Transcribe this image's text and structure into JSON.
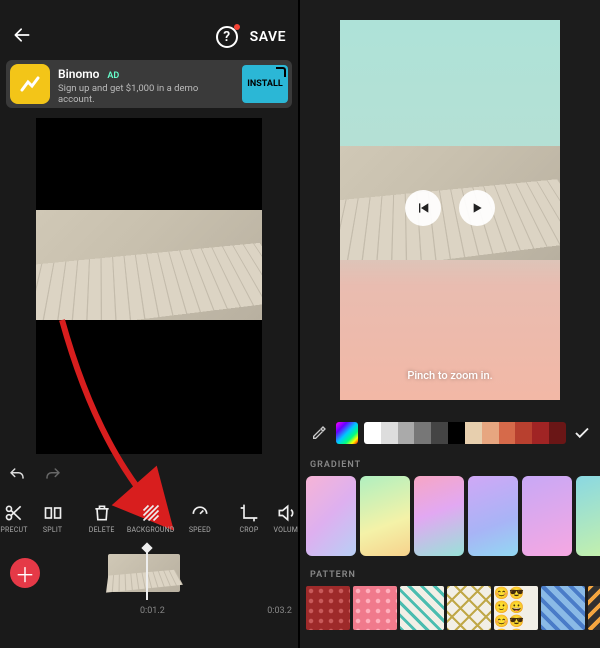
{
  "left": {
    "save_label": "SAVE",
    "ad": {
      "title": "Binomo",
      "tag": "AD",
      "subtitle": "Sign up and get $1,000 in a demo account.",
      "cta": "INSTALL"
    },
    "tools": {
      "t0": "PRECUT",
      "t1": "SPLIT",
      "t2": "DELETE",
      "t3": "BACKGROUND",
      "t4": "SPEED",
      "t5": "CROP",
      "t6": "VOLUM"
    },
    "timeline": {
      "current": "0:01.2",
      "total": "0:03.2"
    }
  },
  "right": {
    "hint": "Pinch to zoom in.",
    "section_gradient": "GRADIENT",
    "section_pattern": "PATTERN",
    "swatches": [
      "#ffffff",
      "#dddddd",
      "#aaaaaa",
      "#777777",
      "#444444",
      "#000000",
      "#e7cfae",
      "#e7a680",
      "#d66a4a",
      "#b8402f",
      "#a02424",
      "#6a1616"
    ],
    "gradients": [
      "linear-gradient(135deg,#f7b4d6 0%,#ddb0f0 50%,#b8cff5 100%)",
      "linear-gradient(160deg,#b0f0c0 0%,#f4f2a8 60%,#f6d28c 100%)",
      "linear-gradient(160deg,#f7a6c4 0%,#e2a8f2 45%,#98e2d8 100%)",
      "linear-gradient(160deg,#d0a8f6 0%,#a8b4f6 60%,#92d8f2 100%)",
      "linear-gradient(160deg,#c8a8f6 0%,#f6a8e2 100%)",
      "linear-gradient(160deg,#8ad8e2 0%,#c8f2a8 100%)"
    ],
    "patterns": [
      {
        "bg": "#9e2a2a",
        "fg": "#c85a5a",
        "type": "dots"
      },
      {
        "bg": "#f07a8c",
        "fg": "#ffb0bd",
        "type": "dots"
      },
      {
        "bg": "#f2efe6",
        "fg": "#4abdb0",
        "type": "diag"
      },
      {
        "bg": "#f2efe6",
        "fg": "#c0a848",
        "type": "diamond"
      },
      {
        "bg": "#f2efe6",
        "fg": "#f4c430",
        "type": "emoji"
      },
      {
        "bg": "#8abae6",
        "fg": "#4a7cc8",
        "type": "cross"
      },
      {
        "bg": "#303030",
        "fg": "#f4a640",
        "type": "diag2"
      }
    ]
  }
}
